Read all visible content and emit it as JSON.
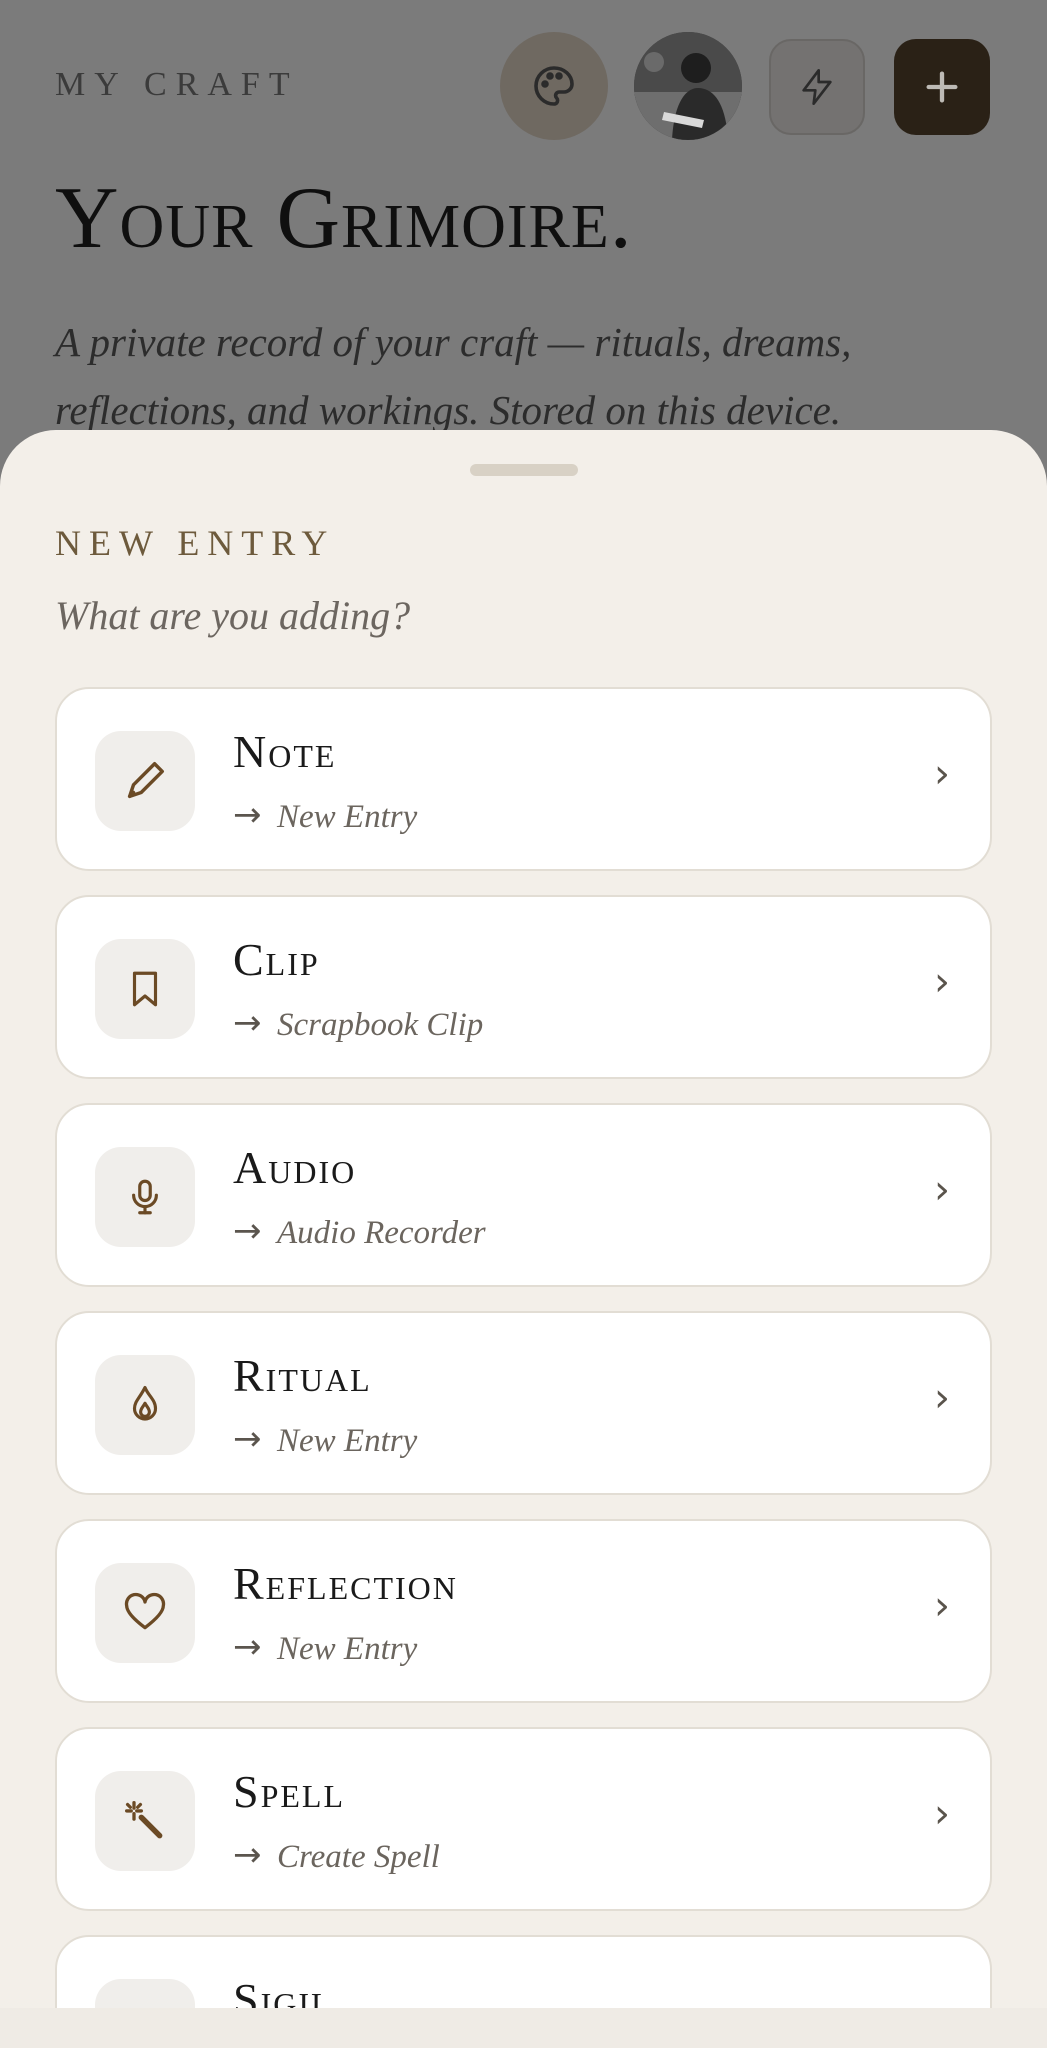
{
  "header": {
    "kicker": "MY CRAFT",
    "title": "Your Grimoire.",
    "subtitle": "A private record of your craft — rituals, dreams, reflections, and workings. Stored on this device."
  },
  "actions": [
    {
      "name": "palette-icon"
    },
    {
      "name": "avatar"
    },
    {
      "name": "bolt-icon"
    },
    {
      "name": "plus-icon"
    }
  ],
  "sheet": {
    "kicker": "NEW ENTRY",
    "prompt": "What are you adding?",
    "options": [
      {
        "title": "Note",
        "arrow": "→",
        "subtitle": "New Entry",
        "icon": "pencil-icon"
      },
      {
        "title": "Clip",
        "arrow": "→",
        "subtitle": "Scrapbook Clip",
        "icon": "bookmark-icon"
      },
      {
        "title": "Audio",
        "arrow": "→",
        "subtitle": "Audio Recorder",
        "icon": "microphone-icon"
      },
      {
        "title": "Ritual",
        "arrow": "→",
        "subtitle": "New Entry",
        "icon": "flame-icon"
      },
      {
        "title": "Reflection",
        "arrow": "→",
        "subtitle": "New Entry",
        "icon": "heart-icon"
      },
      {
        "title": "Spell",
        "arrow": "→",
        "subtitle": "Create Spell",
        "icon": "magic-wand-icon"
      },
      {
        "title": "Sigil",
        "arrow": "",
        "subtitle": "",
        "icon": "sigil-icon"
      }
    ],
    "chevron": "›"
  },
  "colors": {
    "accent": "#2a2116",
    "sheet_bg": "#f3efe9",
    "kicker_gold": "#6d5a3c",
    "icon_stroke": "#6b4a25"
  }
}
